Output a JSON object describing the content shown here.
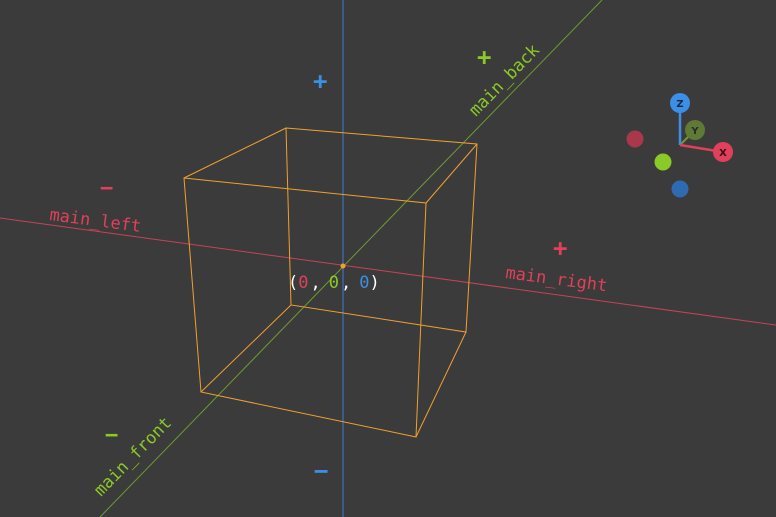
{
  "scene": {
    "colors": {
      "background": "#3b3b3b",
      "x_axis": "#e0405a",
      "y_axis": "#8ac926",
      "z_axis": "#3d8ee6",
      "selection": "#f0a030",
      "origin_text": "#ffffff"
    },
    "axes": {
      "x": {
        "name": "X",
        "positive_label": "main_right",
        "negative_label": "main_left",
        "plus_sign": "+",
        "minus_sign": "−"
      },
      "y": {
        "name": "Y",
        "positive_label": "main_back",
        "negative_label": "main_front",
        "plus_sign": "+",
        "minus_sign": "−"
      },
      "z": {
        "name": "Z",
        "plus_sign": "+",
        "minus_sign": "−"
      }
    },
    "origin": {
      "open": "(",
      "x": "0",
      "sep1": ",",
      "y": "0",
      "sep2": ",",
      "z": "0",
      "close": ")"
    },
    "gizmo": {
      "x_label": "X",
      "y_label": "Y",
      "z_label": "Z"
    }
  }
}
